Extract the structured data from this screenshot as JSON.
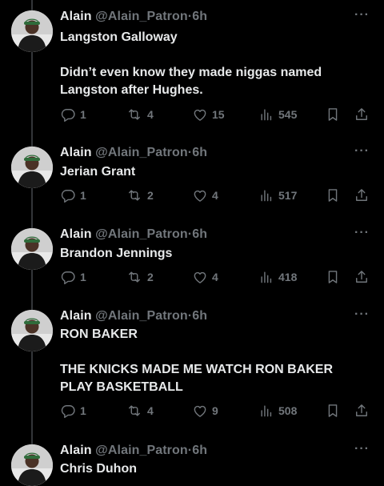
{
  "tweets": [
    {
      "name": "Alain",
      "handle": "@Alain_Patron",
      "dot": "·",
      "time": "6h",
      "text": "Langston Galloway\n\nDidn’t even know they made niggas named Langston after Hughes.",
      "replies": "1",
      "retweets": "4",
      "likes": "15",
      "views": "545"
    },
    {
      "name": "Alain",
      "handle": "@Alain_Patron",
      "dot": "·",
      "time": "6h",
      "text": "Jerian Grant",
      "replies": "1",
      "retweets": "2",
      "likes": "4",
      "views": "517"
    },
    {
      "name": "Alain",
      "handle": "@Alain_Patron",
      "dot": "·",
      "time": "6h",
      "text": "Brandon Jennings",
      "replies": "1",
      "retweets": "2",
      "likes": "4",
      "views": "418"
    },
    {
      "name": "Alain",
      "handle": "@Alain_Patron",
      "dot": "·",
      "time": "6h",
      "text": "RON BAKER\n\nTHE KNICKS MADE ME WATCH RON BAKER PLAY BASKETBALL",
      "replies": "1",
      "retweets": "4",
      "likes": "9",
      "views": "508"
    },
    {
      "name": "Alain",
      "handle": "@Alain_Patron",
      "dot": "·",
      "time": "6h",
      "text": "Chris Duhon"
    }
  ],
  "more_label": "···",
  "icons": {
    "reply": "reply-icon",
    "retweet": "retweet-icon",
    "like": "heart-icon",
    "views": "views-icon",
    "bookmark": "bookmark-icon",
    "share": "share-icon",
    "more": "more-icon"
  },
  "colors": {
    "background": "#000000",
    "text": "#e7e9ea",
    "secondary": "#71767b",
    "thread_line": "#333639"
  }
}
